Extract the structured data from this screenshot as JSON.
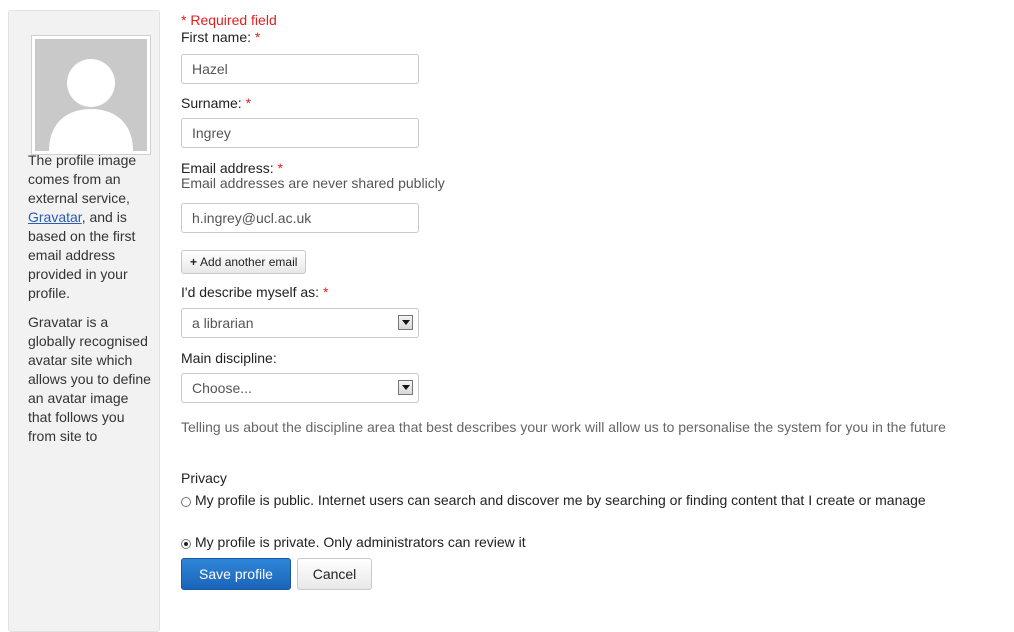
{
  "sidebar": {
    "avatar_alt": "default avatar",
    "paragraph1_before": "The profile image comes from an external service, ",
    "gravatar_link": "Gravatar",
    "paragraph1_after": ", and is based on the first email address provided in your profile.",
    "paragraph2": "Gravatar is a globally recognised avatar site which allows you to define an avatar image that follows you from site to"
  },
  "form": {
    "required_note": "* Required field",
    "first_name": {
      "label": "First name:",
      "star": "*",
      "value": "Hazel"
    },
    "surname": {
      "label": "Surname:",
      "star": "*",
      "value": "Ingrey"
    },
    "email": {
      "label": "Email address:",
      "star": "*",
      "hint": "Email addresses are never shared publicly",
      "value": "h.ingrey@ucl.ac.uk"
    },
    "add_email_label": "Add another email",
    "describe": {
      "label": "I'd describe myself as:",
      "star": "*",
      "selected": "a librarian"
    },
    "discipline": {
      "label": "Main discipline:",
      "selected": "Choose...",
      "help": "Telling us about the discipline area that best describes your work will allow us to personalise the system for you in the future"
    },
    "privacy": {
      "label": "Privacy",
      "options": [
        {
          "label": "My profile is public. Internet users can search and discover me by searching or finding content that I create or manage",
          "checked": false
        },
        {
          "label": "My profile is private. Only administrators can review it",
          "checked": true
        }
      ]
    },
    "save_label": "Save profile",
    "cancel_label": "Cancel"
  },
  "colors": {
    "required": "#e02020",
    "primary_button": "#1a64b8",
    "link": "#2a5db0"
  }
}
